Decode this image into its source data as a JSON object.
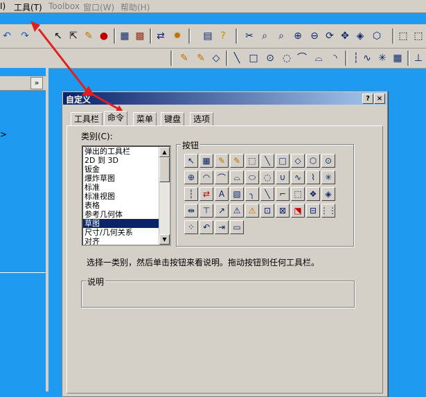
{
  "menubar": {
    "items": [
      {
        "label": "I)",
        "enabled": true
      },
      {
        "label": "工具(T)",
        "enabled": true
      },
      {
        "label": "Toolbox",
        "enabled": false
      },
      {
        "label": "窗口(W)",
        "enabled": false
      },
      {
        "label": "帮助(H)",
        "enabled": false
      }
    ]
  },
  "dialog": {
    "title": "自定义",
    "help_label": "?",
    "close_label": "×",
    "tabs": [
      "工具栏",
      "命令",
      "菜单",
      "键盘",
      "选项"
    ],
    "active_tab": "命令",
    "categories_label": "类别(C):",
    "categories": [
      "弹出的工具栏",
      "2D 到 3D",
      "钣金",
      "爆炸草图",
      "标准",
      "标准视图",
      "表格",
      "参考几何体",
      "草图",
      "尺寸/几何关系",
      "对齐"
    ],
    "selected_category": "草图",
    "buttons_label": "按钮",
    "hint": "选择一类别，然后单击按钮来看说明。拖动按钮到任何工具栏。",
    "description_label": "说明"
  },
  "left_panel": {
    "collapse_label": "»",
    "side_char": ">"
  },
  "annotation_color": "#e02020"
}
